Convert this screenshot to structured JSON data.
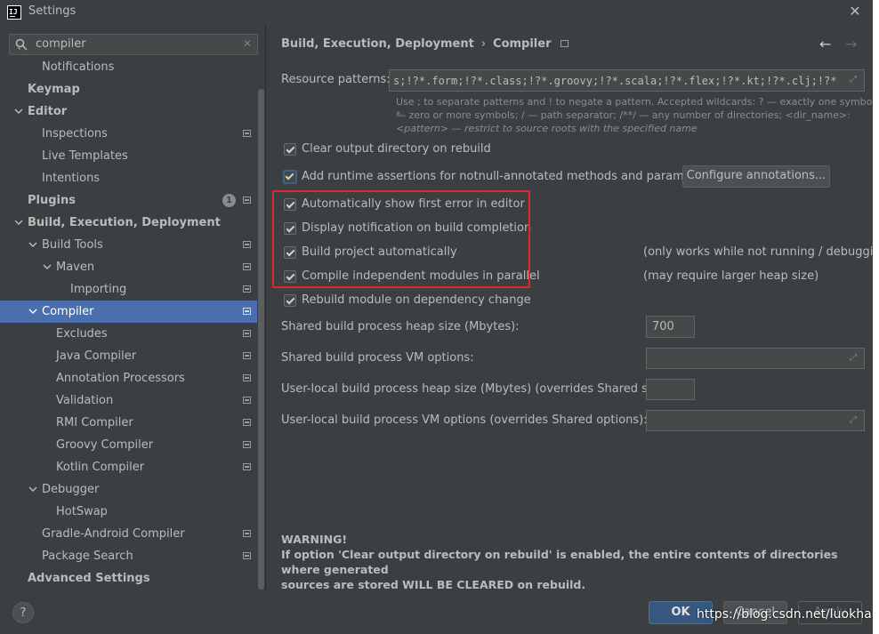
{
  "window": {
    "title": "Settings"
  },
  "search": {
    "value": "compiler"
  },
  "sidebar": {
    "items": [
      {
        "label": "Notifications"
      },
      {
        "label": "Keymap"
      },
      {
        "label": "Editor"
      },
      {
        "label": "Inspections"
      },
      {
        "label": "Live Templates"
      },
      {
        "label": "Intentions"
      },
      {
        "label": "Plugins",
        "badge": "1"
      },
      {
        "label": "Build, Execution, Deployment"
      },
      {
        "label": "Build Tools"
      },
      {
        "label": "Maven"
      },
      {
        "label": "Importing"
      },
      {
        "label": "Compiler"
      },
      {
        "label": "Excludes"
      },
      {
        "label": "Java Compiler"
      },
      {
        "label": "Annotation Processors"
      },
      {
        "label": "Validation"
      },
      {
        "label": "RMI Compiler"
      },
      {
        "label": "Groovy Compiler"
      },
      {
        "label": "Kotlin Compiler"
      },
      {
        "label": "Debugger"
      },
      {
        "label": "HotSwap"
      },
      {
        "label": "Gradle-Android Compiler"
      },
      {
        "label": "Package Search"
      },
      {
        "label": "Advanced Settings"
      }
    ]
  },
  "breadcrumb": {
    "parent": "Build, Execution, Deployment",
    "separator": "›",
    "current": "Compiler"
  },
  "resource_patterns": {
    "label": "Resource patterns:",
    "value": "s;!?*.form;!?*.class;!?*.groovy;!?*.scala;!?*.flex;!?*.kt;!?*.clj;!?*.aj",
    "hint_line1": "Use ; to separate patterns and ! to negate a pattern. Accepted wildcards: ? — exactly one symbol; *",
    "hint_line2": "— zero or more symbols; / — path separator; /**/ — any number of directories; <dir_name>:",
    "hint_line3": "<pattern> — restrict to source roots with the specified name"
  },
  "options": {
    "clear_output": "Clear output directory on rebuild",
    "add_runtime": "Add runtime assertions for notnull-annotated methods and parameters",
    "configure_annotations": "Configure annotations...",
    "auto_show_error": "Automatically show first error in editor",
    "display_notification": "Display notification on build completion",
    "build_auto": "Build project automatically",
    "build_auto_note": "(only works while not running / debugging)",
    "compile_parallel": "Compile independent modules in parallel",
    "compile_parallel_note": "(may require larger heap size)",
    "rebuild_module": "Rebuild module on dependency change"
  },
  "fields": {
    "shared_heap_label": "Shared build process heap size (Mbytes):",
    "shared_heap_value": "700",
    "shared_vm_label": "Shared build process VM options:",
    "user_heap_label": "User-local build process heap size (Mbytes) (overrides Shared size):",
    "user_vm_label": "User-local build process VM options (overrides Shared options):"
  },
  "warning": {
    "title": "WARNING!",
    "line1": "If option 'Clear output directory on rebuild' is enabled, the entire contents of directories where generated",
    "line2": "sources are stored WILL BE CLEARED on rebuild."
  },
  "buttons": {
    "help": "?",
    "ok": "OK",
    "cancel": "Cancel",
    "apply": "Apply"
  },
  "watermark": "https://blog.csdn.net/luokha"
}
